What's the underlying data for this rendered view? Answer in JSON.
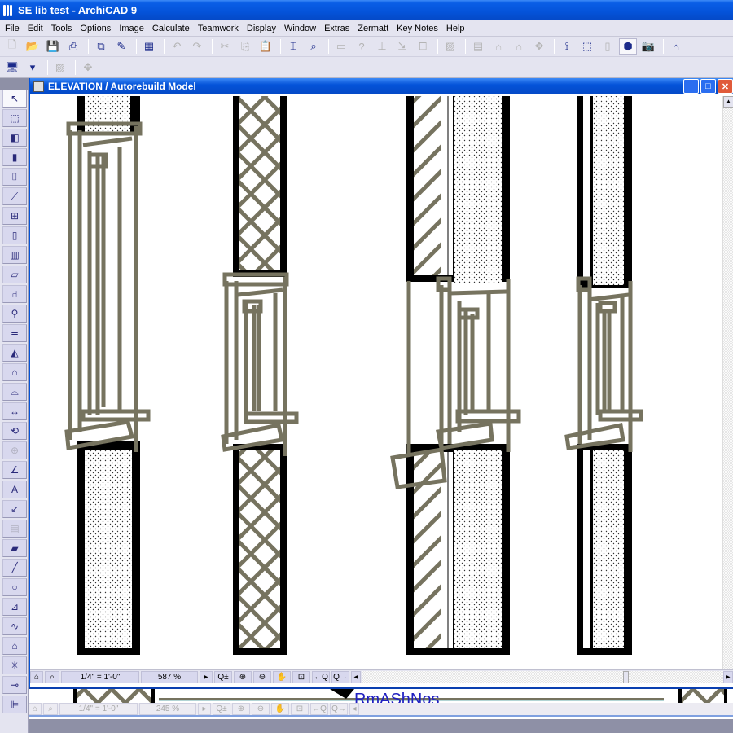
{
  "app": {
    "title": "SE lib test - ArchiCAD 9"
  },
  "menu": [
    "File",
    "Edit",
    "Tools",
    "Options",
    "Image",
    "Calculate",
    "Teamwork",
    "Display",
    "Window",
    "Extras",
    "Zermatt",
    "Key Notes",
    "Help"
  ],
  "toolbar1": [
    {
      "name": "new-icon",
      "glyph": "🗋",
      "enabled": false
    },
    {
      "name": "open-icon",
      "glyph": "📂",
      "enabled": false
    },
    {
      "name": "save-icon",
      "glyph": "💾",
      "enabled": true
    },
    {
      "name": "print-icon",
      "glyph": "⎙",
      "enabled": true
    },
    {
      "sep": true
    },
    {
      "name": "plot-icon",
      "glyph": "⧉",
      "enabled": true
    },
    {
      "name": "pen-icon",
      "glyph": "✎",
      "enabled": true
    },
    {
      "sep": true
    },
    {
      "name": "layout-icon",
      "glyph": "▦",
      "enabled": true
    },
    {
      "sep": true
    },
    {
      "name": "undo-icon",
      "glyph": "↶",
      "enabled": false
    },
    {
      "name": "redo-icon",
      "glyph": "↷",
      "enabled": false
    },
    {
      "sep": true
    },
    {
      "name": "cut-icon",
      "glyph": "✂",
      "enabled": false
    },
    {
      "name": "copy-icon",
      "glyph": "⎘",
      "enabled": false
    },
    {
      "name": "paste-icon",
      "glyph": "📋",
      "enabled": true
    },
    {
      "sep": true
    },
    {
      "name": "dimension-icon",
      "glyph": "⌶",
      "enabled": true
    },
    {
      "name": "find-icon",
      "glyph": "⌕",
      "enabled": true
    },
    {
      "sep": true
    },
    {
      "name": "element-info-icon",
      "glyph": "▭",
      "enabled": false
    },
    {
      "name": "tool-b-icon",
      "glyph": "?",
      "enabled": false
    },
    {
      "name": "tool-c-icon",
      "glyph": "⊥",
      "enabled": false
    },
    {
      "name": "tool-d-icon",
      "glyph": "⇲",
      "enabled": false
    },
    {
      "name": "tool-e-icon",
      "glyph": "⧠",
      "enabled": false
    },
    {
      "sep": true
    },
    {
      "name": "hatch-icon",
      "glyph": "▨",
      "enabled": false
    },
    {
      "sep": true
    },
    {
      "name": "floorplan-icon",
      "glyph": "▤",
      "enabled": false
    },
    {
      "name": "section-icon",
      "glyph": "⌂",
      "enabled": false
    },
    {
      "name": "elevation-icon",
      "glyph": "⌂",
      "enabled": false
    },
    {
      "name": "detail-icon",
      "glyph": "✥",
      "enabled": false
    },
    {
      "sep": true
    },
    {
      "name": "axon-icon",
      "glyph": "⟟",
      "enabled": true
    },
    {
      "name": "3d-window-icon",
      "glyph": "⬚",
      "enabled": true
    },
    {
      "name": "3d-disabled-icon",
      "glyph": "▯",
      "enabled": false
    },
    {
      "name": "3d-model-icon",
      "glyph": "⬢",
      "enabled": true,
      "active": true
    },
    {
      "name": "camera-icon",
      "glyph": "📷",
      "enabled": true
    },
    {
      "sep": true
    },
    {
      "name": "house-icon",
      "glyph": "⌂",
      "enabled": true
    }
  ],
  "toolbar2": [
    {
      "name": "display-options-icon",
      "glyph": "🖥",
      "enabled": true
    },
    {
      "name": "dropdown-arrow-icon",
      "glyph": "▾",
      "enabled": true
    },
    {
      "sep": true
    },
    {
      "name": "fill-icon",
      "glyph": "▨",
      "enabled": false
    },
    {
      "sep": true
    },
    {
      "name": "trace-icon",
      "glyph": "✥",
      "enabled": false
    }
  ],
  "toolbox": [
    {
      "name": "arrow-tool-icon",
      "glyph": "↖",
      "selected": true
    },
    {
      "name": "marquee-tool-icon",
      "glyph": "⬚"
    },
    {
      "name": "wall-tool-icon",
      "glyph": "◧"
    },
    {
      "name": "column-tool-icon",
      "glyph": "▮"
    },
    {
      "name": "cylinder-tool-icon",
      "glyph": "⌷"
    },
    {
      "name": "beam-tool-icon",
      "glyph": "⟋"
    },
    {
      "name": "window-tool-icon",
      "glyph": "⊞"
    },
    {
      "name": "door-tool-icon",
      "glyph": "▯"
    },
    {
      "name": "curtain-wall-tool-icon",
      "glyph": "▥"
    },
    {
      "name": "slab-tool-icon",
      "glyph": "▱"
    },
    {
      "name": "object-tool-icon",
      "glyph": "⑁"
    },
    {
      "name": "lamp-tool-icon",
      "glyph": "⚲"
    },
    {
      "name": "stair-tool-icon",
      "glyph": "≣"
    },
    {
      "name": "roof-slab-tool-icon",
      "glyph": "◭"
    },
    {
      "name": "roof-tool-icon",
      "glyph": "⌂"
    },
    {
      "name": "mesh-tool-icon",
      "glyph": "⌓"
    },
    {
      "name": "linear-dimension-tool-icon",
      "glyph": "↔"
    },
    {
      "name": "radial-dimension-tool-icon",
      "glyph": "⟲"
    },
    {
      "name": "level-dimension-tool-icon",
      "glyph": "⊕",
      "disabled": true
    },
    {
      "name": "angle-dimension-tool-icon",
      "glyph": "∠"
    },
    {
      "name": "text-tool-icon",
      "glyph": "A"
    },
    {
      "name": "label-tool-icon",
      "glyph": "↙"
    },
    {
      "name": "zone-tool-icon",
      "glyph": "▤",
      "disabled": true
    },
    {
      "name": "fill-tool-icon",
      "glyph": "▰"
    },
    {
      "name": "line-tool-icon",
      "glyph": "╱"
    },
    {
      "name": "circle-tool-icon",
      "glyph": "○"
    },
    {
      "name": "polyline-tool-icon",
      "glyph": "⊿"
    },
    {
      "name": "spline-tool-icon",
      "glyph": "∿"
    },
    {
      "name": "figure-tool-icon",
      "glyph": "⌂"
    },
    {
      "name": "hotspot-tool-icon",
      "glyph": "✳"
    },
    {
      "name": "section-tool-icon",
      "glyph": "⊸"
    },
    {
      "name": "elevation-tool-icon",
      "glyph": "⊫"
    }
  ],
  "window": {
    "title": "ELEVATION / Autorebuild Model",
    "scale": "1/4\"   =   1'-0\"",
    "zoom": "587 %"
  },
  "window2": {
    "scale": "1/4\"   =   1'-0\"",
    "zoom": "245 %",
    "label": "RmAShNos"
  },
  "status_buttons": [
    {
      "name": "zoom-in-out-icon",
      "glyph": "Q±"
    },
    {
      "name": "zoom-in-icon",
      "glyph": "⊕"
    },
    {
      "name": "zoom-out-icon",
      "glyph": "⊖"
    },
    {
      "name": "pan-icon",
      "glyph": "✋"
    },
    {
      "name": "fit-in-window-icon",
      "glyph": "⊡"
    },
    {
      "name": "previous-zoom-icon",
      "glyph": "←Q"
    },
    {
      "name": "next-zoom-icon",
      "glyph": "Q→"
    }
  ],
  "colors": {
    "frame": "#76735f",
    "wall": "#000000",
    "titlebar": "#0453d9"
  }
}
